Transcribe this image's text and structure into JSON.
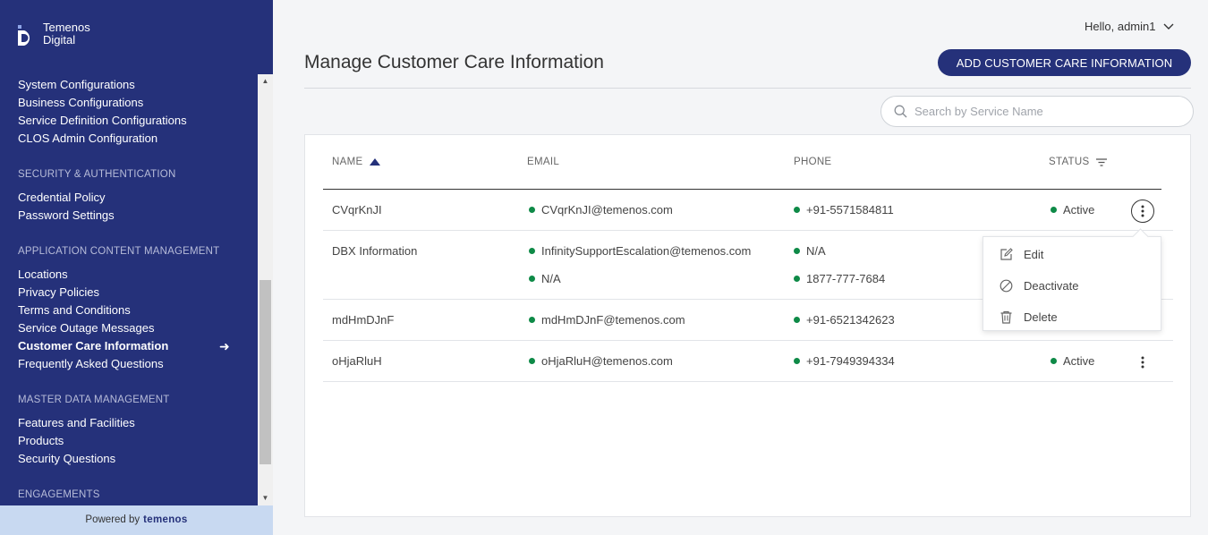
{
  "brand": {
    "line1": "Temenos",
    "line2": "Digital",
    "powered_label": "Powered by",
    "powered_brand": "temenos"
  },
  "nav": {
    "config_items": [
      "System Configurations",
      "Business Configurations",
      "Service Definition Configurations",
      "CLOS Admin Configuration"
    ],
    "security_section": "SECURITY & AUTHENTICATION",
    "security_items": [
      "Credential Policy",
      "Password Settings"
    ],
    "content_section": "APPLICATION CONTENT MANAGEMENT",
    "content_items": [
      "Locations",
      "Privacy Policies",
      "Terms and Conditions",
      "Service Outage Messages",
      "Customer Care Information",
      "Frequently Asked Questions"
    ],
    "master_section": "MASTER DATA MANAGEMENT",
    "master_items": [
      "Features and Facilities",
      "Products",
      "Security Questions"
    ],
    "engagements_section": "ENGAGEMENTS"
  },
  "header": {
    "greeting": "Hello, admin1",
    "title": "Manage Customer Care Information",
    "add_button": "ADD CUSTOMER CARE INFORMATION"
  },
  "search": {
    "placeholder": "Search by Service Name"
  },
  "table": {
    "columns": {
      "name": "NAME",
      "email": "EMAIL",
      "phone": "PHONE",
      "status": "STATUS"
    },
    "rows": [
      {
        "name": "CVqrKnJI",
        "emails": [
          "CVqrKnJI@temenos.com"
        ],
        "phones": [
          "+91-5571584811"
        ],
        "status": "Active"
      },
      {
        "name": "DBX Information",
        "emails": [
          "InfinitySupportEscalation@temenos.com",
          "N/A"
        ],
        "phones": [
          "N/A",
          "1877-777-7684"
        ],
        "status": ""
      },
      {
        "name": "mdHmDJnF",
        "emails": [
          "mdHmDJnF@temenos.com"
        ],
        "phones": [
          "+91-6521342623"
        ],
        "status": ""
      },
      {
        "name": "oHjaRluH",
        "emails": [
          "oHjaRluH@temenos.com"
        ],
        "phones": [
          "+91-7949394334"
        ],
        "status": "Active"
      }
    ]
  },
  "context_menu": {
    "edit": "Edit",
    "deactivate": "Deactivate",
    "delete": "Delete"
  },
  "colors": {
    "sidebar": "#25317a",
    "status_active": "#0e8a47",
    "powered_bg": "#c8d9f1"
  }
}
